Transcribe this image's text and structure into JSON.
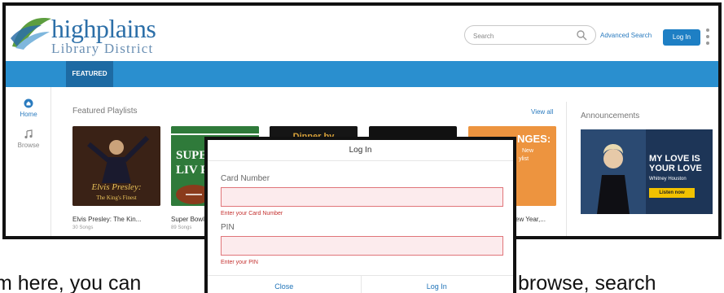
{
  "header": {
    "logo_line1": "highplains",
    "logo_line2": "Library District",
    "search_placeholder": "Search",
    "advanced_search": "Advanced Search",
    "login_label": "Log In"
  },
  "nav": {
    "tab_featured": "FEATURED"
  },
  "rail": {
    "items": [
      {
        "label": "Home",
        "icon": "home-icon"
      },
      {
        "label": "Browse",
        "icon": "music-note-icon"
      }
    ]
  },
  "featured": {
    "title": "Featured Playlists",
    "view_all": "View all",
    "cards": [
      {
        "title": "Elvis Presley: The Kin...",
        "subtitle": "30 Songs",
        "art_text": "Elvis Presley: The King's Finest"
      },
      {
        "title": "Super Bowl",
        "subtitle": "89 Songs",
        "art_text": "SUPER LIV P"
      },
      {
        "title": "",
        "subtitle": "",
        "art_text": "Dinner by"
      },
      {
        "title": "",
        "subtitle": "",
        "art_text": ""
      },
      {
        "title": "ew Year,...",
        "subtitle": "",
        "art_text": "NGES: New ylist"
      }
    ]
  },
  "announcements": {
    "title": "Announcements",
    "banner_headline": "MY LOVE IS YOUR LOVE",
    "banner_artist": "Whitney Houston",
    "banner_button": "Listen now"
  },
  "modal": {
    "title": "Log In",
    "card_label": "Card Number",
    "card_error": "Enter your Card Number",
    "pin_label": "PIN",
    "pin_error": "Enter your PIN",
    "close_label": "Close",
    "login_label": "Log In"
  },
  "background_text": {
    "left": "m here, you can",
    "right": "browse, search"
  },
  "colors": {
    "brand_blue": "#2a8fcf",
    "nav_active": "#1d6aa3",
    "error_red": "#c4312f"
  }
}
